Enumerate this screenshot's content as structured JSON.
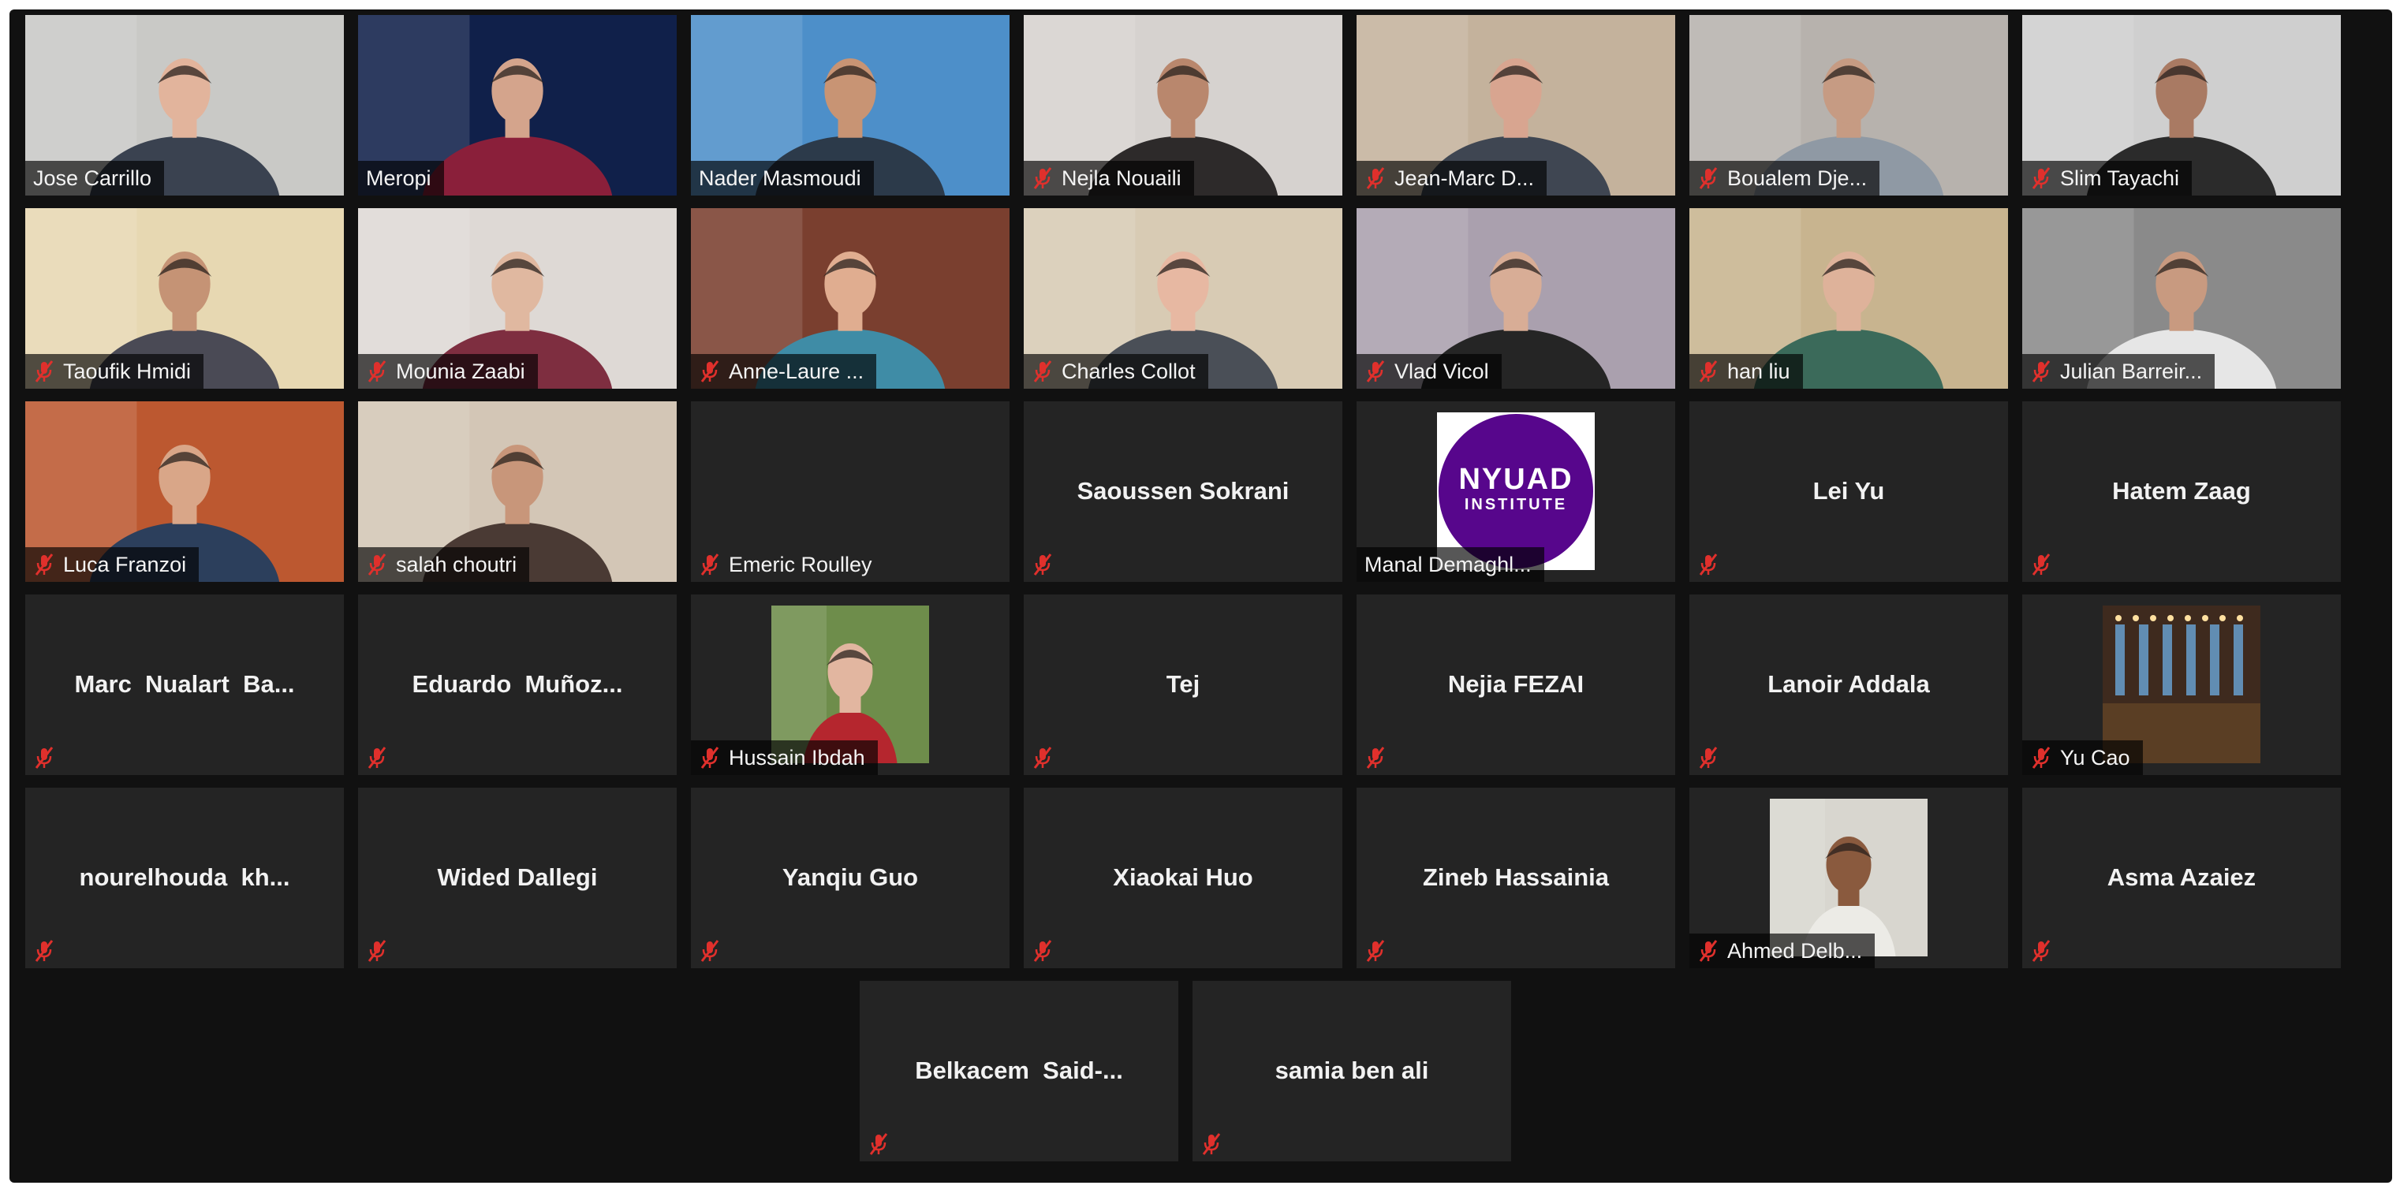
{
  "meeting": {
    "accent_active_speaker": "#b5dd3a",
    "tile_background": "#242424",
    "muted_icon_color": "#e0302c",
    "participants": [
      {
        "name": "Jose Carrillo",
        "video": "on",
        "bg": "#c9c9c6",
        "skin": "#e2b49c",
        "cloth": "#3a4250",
        "muted": false
      },
      {
        "name": "Meropi",
        "video": "on",
        "bg": "#10204a",
        "skin": "#d4a48c",
        "cloth": "#8a1f3a",
        "muted": false
      },
      {
        "name": "Nader Masmoudi",
        "video": "on",
        "bg": "#4d8fc9",
        "skin": "#c89474",
        "cloth": "#2c3a4a",
        "muted": false
      },
      {
        "name": "Nejla Nouaili",
        "video": "on",
        "bg": "#d6d2cf",
        "skin": "#b9876d",
        "cloth": "#2d2a2a",
        "muted": true
      },
      {
        "name": "Jean-Marc D...",
        "video": "on",
        "bg": "#c4b29c",
        "skin": "#d8a590",
        "cloth": "#3f4652",
        "muted": true
      },
      {
        "name": "Boualem Dje...",
        "video": "on",
        "bg": "#b7b2ad",
        "skin": "#c69b83",
        "cloth": "#8f99a4",
        "muted": true
      },
      {
        "name": "Slim Tayachi",
        "video": "on",
        "bg": "#cfcfcf",
        "skin": "#a97a63",
        "cloth": "#2b2b2b",
        "muted": true
      },
      {
        "name": "Taoufik Hmidi",
        "video": "on",
        "bg": "#e7d8b2",
        "skin": "#c59375",
        "cloth": "#4a4a55",
        "muted": true
      },
      {
        "name": "Mounia Zaabi",
        "video": "on",
        "bg": "#ded9d5",
        "skin": "#e0b8a0",
        "cloth": "#7e2e40",
        "muted": true
      },
      {
        "name": "Anne-Laure ...",
        "video": "on",
        "bg": "#7a3f2f",
        "skin": "#e0ad90",
        "cloth": "#3f8ca6",
        "muted": true
      },
      {
        "name": "Charles Collot",
        "video": "on",
        "bg": "#d8cbb4",
        "skin": "#e7b8a2",
        "cloth": "#4a4f57",
        "muted": true
      },
      {
        "name": "Vlad Vicol",
        "video": "on",
        "bg": "#aaa0ae",
        "skin": "#d8ad96",
        "cloth": "#252525",
        "muted": true
      },
      {
        "name": "han liu",
        "video": "on",
        "bg": "#c8b48f",
        "skin": "#deb29a",
        "cloth": "#3b6a5a",
        "muted": true
      },
      {
        "name": "Julian Barreir...",
        "video": "on",
        "bg": "#8a8a8a",
        "skin": "#c89a80",
        "cloth": "#e6e6e6",
        "muted": true
      },
      {
        "name": "Luca Franzoi",
        "video": "on",
        "bg": "#bc5830",
        "skin": "#d9a688",
        "cloth": "#2c3f5c",
        "muted": true
      },
      {
        "name": "salah choutri",
        "video": "on",
        "bg": "#d3c6b6",
        "skin": "#c8967a",
        "cloth": "#4a3a34",
        "muted": true
      },
      {
        "name": "Emeric Roulley",
        "video": "off",
        "display": "",
        "muted": true
      },
      {
        "name": "",
        "video": "off",
        "display": "Saoussen Sokrani",
        "muted": true
      },
      {
        "name": "Manal Demaghl...",
        "video": "logo",
        "logo_line1": "NYUAD",
        "logo_line2": "INSTITUTE",
        "logo_color": "#57068c",
        "muted": false
      },
      {
        "name": "",
        "video": "off",
        "display": "Lei Yu",
        "muted": true
      },
      {
        "name": "",
        "video": "off",
        "display": "Hatem Zaag",
        "muted": true
      },
      {
        "name": "",
        "video": "off",
        "display": "Marc  Nualart  Ba...",
        "muted": true
      },
      {
        "name": "",
        "video": "off",
        "display": "Eduardo  Muñoz...",
        "muted": true
      },
      {
        "name": "Hussain Ibdah",
        "video": "avatar",
        "bg": "#6e8d4b",
        "skin": "#e2b6a0",
        "cloth": "#b5262e",
        "muted": true
      },
      {
        "name": "",
        "video": "off",
        "display": "Tej",
        "muted": true
      },
      {
        "name": "",
        "video": "off",
        "display": "Nejia FEZAI",
        "muted": true
      },
      {
        "name": "",
        "video": "off",
        "display": "Lanoir Addala",
        "muted": true
      },
      {
        "name": "Yu Cao",
        "video": "avatar-hall",
        "bg": "#3e2a1e",
        "muted": true
      },
      {
        "name": "",
        "video": "off",
        "display": "nourelhouda  kh...",
        "muted": true
      },
      {
        "name": "",
        "video": "off",
        "display": "Wided Dallegi",
        "muted": true
      },
      {
        "name": "",
        "video": "off",
        "display": "Yanqiu Guo",
        "muted": true
      },
      {
        "name": "",
        "video": "off",
        "display": "Xiaokai Huo",
        "muted": true
      },
      {
        "name": "",
        "video": "off",
        "display": "Zineb Hassainia",
        "muted": true
      },
      {
        "name": "Ahmed Delb...",
        "video": "avatar",
        "bg": "#d8d6cf",
        "skin": "#8a5a3e",
        "cloth": "#ecebe6",
        "muted": true
      },
      {
        "name": "",
        "video": "off",
        "display": "Asma Azaiez",
        "muted": true
      },
      {
        "name": "",
        "video": "off",
        "display": "Belkacem  Said-...",
        "muted": true
      },
      {
        "name": "",
        "video": "off",
        "display": "samia ben ali",
        "muted": true
      }
    ]
  }
}
